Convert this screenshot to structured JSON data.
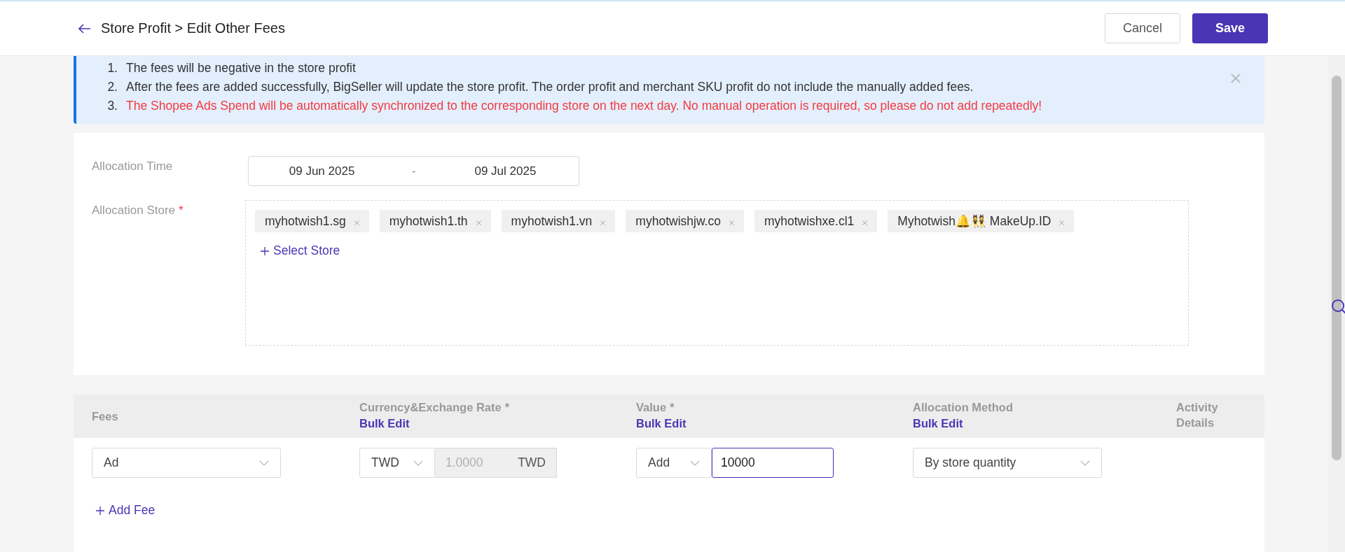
{
  "header": {
    "title": "Store Profit > Edit Other Fees",
    "buttons": [
      {
        "label": "Cancel",
        "kind": "secondary"
      },
      {
        "label": "Save",
        "kind": "primary"
      }
    ]
  },
  "notice": {
    "items": [
      {
        "number": "1.",
        "text": "The fees will be negative in the store profit",
        "kind": "normal"
      },
      {
        "number": "2.",
        "text": "After the fees are added successfully, BigSeller will update the store profit. The order profit and merchant SKU profit do not include the manually added fees.",
        "kind": "normal"
      },
      {
        "number": "3.",
        "text": "The Shopee Ads Spend will be automatically synchronized to the corresponding store on the next day. No manual operation is required, so please do not add repeatedly!",
        "kind": "warning"
      }
    ]
  },
  "allocation_time": {
    "label": "Allocation Time",
    "start": "09 Jun 2025",
    "separator": "-",
    "end": "09 Jul 2025"
  },
  "allocation_store": {
    "label": "Allocation Store",
    "required_mark": "*",
    "stores": [
      "myhotwish1.sg",
      "myhotwish1.th",
      "myhotwish1.vn",
      "myhotwishjw.co",
      "myhotwishxe.cl1",
      "Myhotwish🔔👯 MakeUp.ID"
    ],
    "add_link": "Select Store"
  },
  "fees_table": {
    "columns": [
      {
        "label": "Fees"
      },
      {
        "label": "Currency&Exchange Rate",
        "required_mark": "*",
        "bulk_edit": "Bulk Edit"
      },
      {
        "label": "Value",
        "required_mark": "*",
        "bulk_edit": "Bulk Edit"
      },
      {
        "label": "Allocation Method",
        "bulk_edit": "Bulk Edit"
      },
      {
        "label": "Activity Details"
      }
    ],
    "rows": [
      {
        "fee": "Ad",
        "currency": "TWD",
        "rate": "1.0000",
        "rate_currency": "TWD",
        "operation": "Add",
        "value": "10000",
        "method": "By store quantity"
      }
    ],
    "add_link": "Add Fee"
  }
}
